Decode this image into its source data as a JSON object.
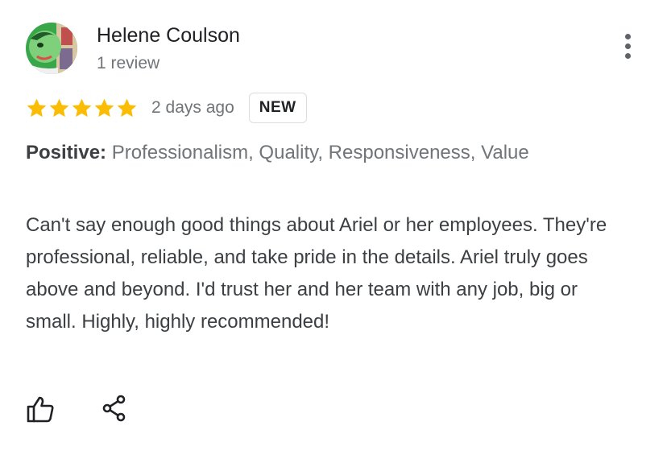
{
  "reviewer": {
    "name": "Helene Coulson",
    "subtitle": "1 review",
    "avatar_icon": "user-avatar-icon"
  },
  "rating": {
    "stars": 5,
    "max": 5,
    "color": "#fbbc04",
    "date": "2 days ago",
    "badge": "NEW"
  },
  "attributes": {
    "label": "Positive:",
    "values": "Professionalism, Quality, Responsiveness, Value"
  },
  "review_text": "Can't say enough good things about Ariel or her employees. They're professional, reliable, and take pride in the details. Ariel truly goes above and beyond. I'd trust her and her team with any job, big or small. Highly, highly recommended!",
  "actions": {
    "like_icon": "thumbs-up-icon",
    "share_icon": "share-icon",
    "more_icon": "more-vert-icon"
  }
}
